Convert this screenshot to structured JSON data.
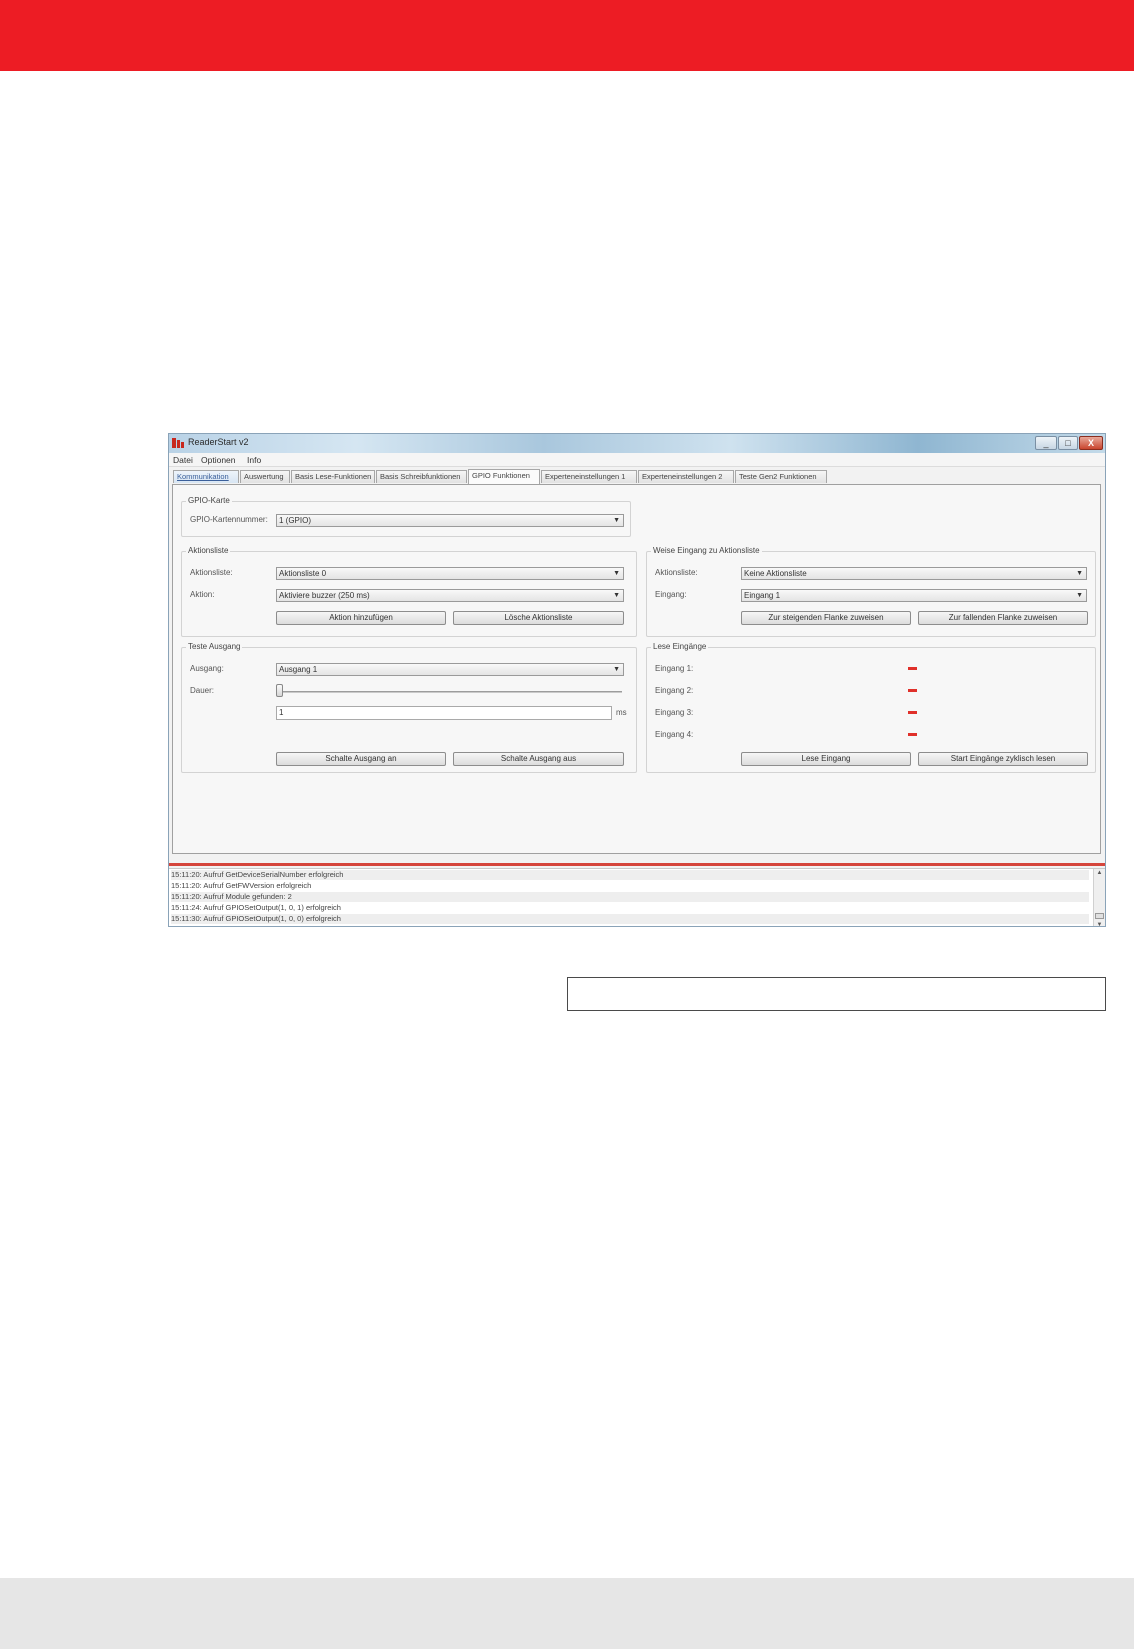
{
  "window": {
    "title": "ReaderStart v2",
    "controls": {
      "minimize": "_",
      "maximize": "□",
      "close": "X"
    }
  },
  "menu": [
    "Datei",
    "Optionen",
    "Info"
  ],
  "tabs": [
    "Kommunikation",
    "Auswertung",
    "Basis Lese-Funktionen",
    "Basis Schreibfunktionen",
    "GPIO Funktionen",
    "Experteneinstellungen 1",
    "Experteneinstellungen 2",
    "Teste Gen2 Funktionen"
  ],
  "gpio_card": {
    "title": "GPIO-Karte",
    "number_label": "GPIO-Kartennummer:",
    "number_value": "1 (GPIO)"
  },
  "action_list": {
    "title": "Aktionsliste",
    "list_label": "Aktionsliste:",
    "list_value": "Aktionsliste 0",
    "action_label": "Aktion:",
    "action_value": "Aktiviere buzzer (250 ms)",
    "add_button": "Aktion hinzufügen",
    "delete_button": "Lösche Aktionsliste"
  },
  "assign_input": {
    "title": "Weise Eingang zu Aktionsliste",
    "list_label": "Aktionsliste:",
    "list_value": "Keine Aktionsliste",
    "input_label": "Eingang:",
    "input_value": "Eingang 1",
    "rising_button": "Zur steigenden Flanke zuweisen",
    "falling_button": "Zur fallenden Flanke zuweisen"
  },
  "test_output": {
    "title": "Teste Ausgang",
    "output_label": "Ausgang:",
    "output_value": "Ausgang 1",
    "duration_label": "Dauer:",
    "duration_value": "1",
    "duration_unit": "ms",
    "on_button": "Schalte Ausgang an",
    "off_button": "Schalte Ausgang aus"
  },
  "read_inputs": {
    "title": "Lese Eingänge",
    "inputs": [
      "Eingang 1:",
      "Eingang 2:",
      "Eingang 3:",
      "Eingang 4:"
    ],
    "read_button": "Lese Eingang",
    "cyclic_button": "Start Eingänge zyklisch lesen"
  },
  "log": [
    "15:11:20: Aufruf GetDeviceSerialNumber erfolgreich",
    "15:11:20: Aufruf GetFWVersion erfolgreich",
    "15:11:20: Aufruf Module gefunden: 2",
    "15:11:24: Aufruf GPIOSetOutput(1, 0, 1) erfolgreich",
    "15:11:30: Aufruf GPIOSetOutput(1, 0, 0) erfolgreich"
  ],
  "colors": {
    "brand_red": "#ed1c24",
    "led_red": "#e0302a",
    "footer_gray": "#e6e6e6"
  }
}
